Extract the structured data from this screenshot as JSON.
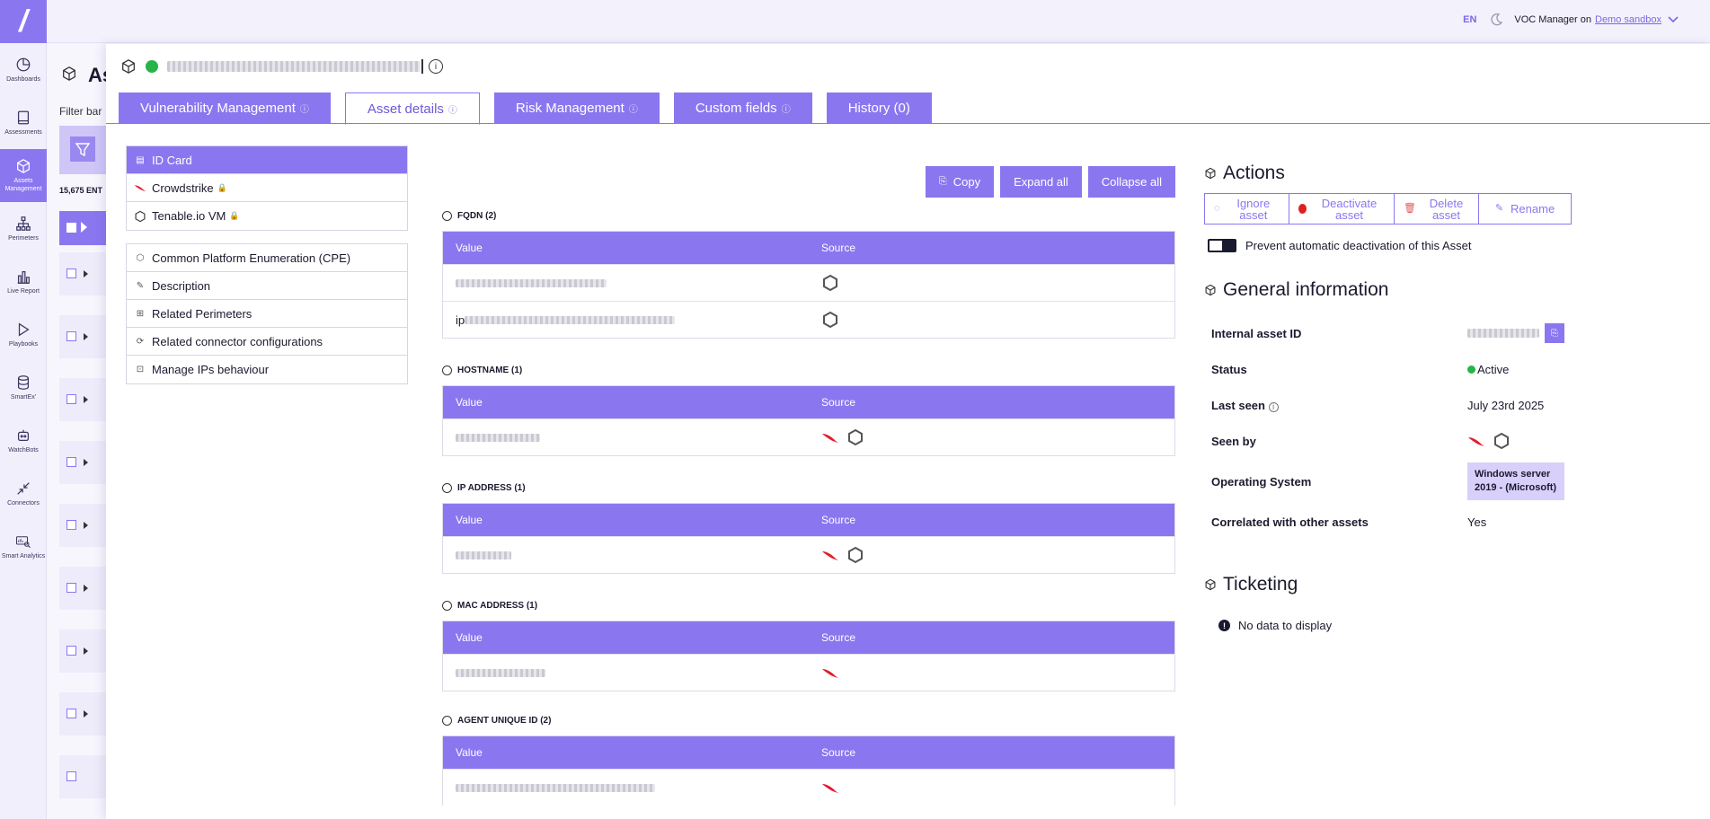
{
  "topbar": {
    "language": "EN",
    "user_role": "VOC Manager on",
    "workspace": "Demo sandbox"
  },
  "sidebar": {
    "items": [
      {
        "label": "Dashboards",
        "icon": "pie-chart-icon"
      },
      {
        "label": "Assessments",
        "icon": "book-icon"
      },
      {
        "label": "Assets Management",
        "icon": "cube-icon",
        "active": true
      },
      {
        "label": "Perimeters",
        "icon": "hierarchy-icon"
      },
      {
        "label": "Live Report",
        "icon": "bar-chart-icon"
      },
      {
        "label": "Playbooks",
        "icon": "play-icon"
      },
      {
        "label": "SmartEx'",
        "icon": "database-icon"
      },
      {
        "label": "WatchBots",
        "icon": "robot-icon"
      },
      {
        "label": "Connectors",
        "icon": "arrows-in-icon"
      },
      {
        "label": "Smart Analytics",
        "icon": "analytics-icon"
      }
    ]
  },
  "background_page": {
    "title": "As",
    "filter_label": "Filter bar",
    "entries_count": "15,675 ENT"
  },
  "drawer": {
    "tabs": [
      {
        "label": "Vulnerability Management",
        "info": "ⓘ"
      },
      {
        "label": "Asset details",
        "info": "ⓘ",
        "active": true
      },
      {
        "label": "Risk Management",
        "info": "ⓘ"
      },
      {
        "label": "Custom fields",
        "info": "ⓘ"
      },
      {
        "label": "History (0)",
        "info": ""
      }
    ],
    "menu_primary": [
      {
        "label": "ID Card",
        "icon": "id-card-icon",
        "active": true
      },
      {
        "label": "Crowdstrike",
        "icon": "crowdstrike-icon",
        "locked": true
      },
      {
        "label": "Tenable.io VM",
        "icon": "tenable-icon",
        "locked": true
      }
    ],
    "menu_secondary": [
      {
        "label": "Common Platform Enumeration (CPE)",
        "icon": "cube-icon"
      },
      {
        "label": "Description",
        "icon": "pencil-icon"
      },
      {
        "label": "Related Perimeters",
        "icon": "hierarchy-icon"
      },
      {
        "label": "Related connector configurations",
        "icon": "refresh-icon"
      },
      {
        "label": "Manage IPs behaviour",
        "icon": "lock-icon"
      }
    ],
    "toolbar": {
      "copy": "Copy",
      "expand_all": "Expand all",
      "collapse_all": "Collapse all"
    },
    "sections": [
      {
        "title": "FQDN (2)",
        "col_value": "Value",
        "col_source": "Source",
        "rows": [
          {
            "prefix": "",
            "sources": [
              "tenable"
            ]
          },
          {
            "prefix": "ip",
            "sources": [
              "tenable"
            ]
          }
        ]
      },
      {
        "title": "HOSTNAME (1)",
        "col_value": "Value",
        "col_source": "Source",
        "rows": [
          {
            "prefix": "",
            "sources": [
              "crowdstrike",
              "tenable"
            ]
          }
        ]
      },
      {
        "title": "IP ADDRESS (1)",
        "col_value": "Value",
        "col_source": "Source",
        "rows": [
          {
            "prefix": "",
            "sources": [
              "crowdstrike",
              "tenable"
            ]
          }
        ]
      },
      {
        "title": "MAC ADDRESS (1)",
        "col_value": "Value",
        "col_source": "Source",
        "rows": [
          {
            "prefix": "",
            "sources": [
              "crowdstrike"
            ]
          }
        ]
      },
      {
        "title": "AGENT UNIQUE ID (2)",
        "col_value": "Value",
        "col_source": "Source",
        "rows": [
          {
            "prefix": "",
            "sources": [
              "crowdstrike"
            ]
          }
        ]
      }
    ],
    "actions": {
      "title": "Actions",
      "ignore": "Ignore asset",
      "deactivate": "Deactivate asset",
      "delete": "Delete asset",
      "rename": "Rename",
      "toggle_label": "Prevent automatic deactivation of this Asset"
    },
    "general": {
      "title": "General information",
      "internal_id_label": "Internal asset ID",
      "status_label": "Status",
      "status_value": "Active",
      "last_seen_label": "Last seen",
      "last_seen_value": "July 23rd 2025",
      "seen_by_label": "Seen by",
      "os_label": "Operating System",
      "os_value": "Windows server 2019 - (Microsoft)",
      "correlated_label": "Correlated with other assets",
      "correlated_value": "Yes"
    },
    "ticketing": {
      "title": "Ticketing",
      "empty": "No data to display"
    }
  },
  "colors": {
    "accent": "#8a77f0",
    "active_green": "#28b44a",
    "danger_red": "#e02020"
  }
}
